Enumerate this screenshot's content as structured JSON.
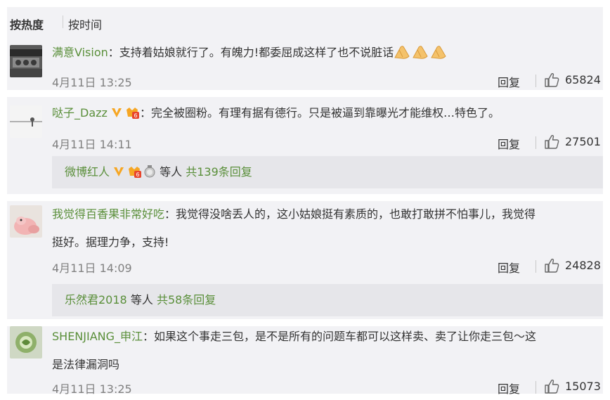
{
  "sort": {
    "hot": "按热度",
    "time": "按时间"
  },
  "comments": [
    {
      "user": "满意Vision",
      "colon": "：",
      "text": "支持着姑娘就行了。有魄力!都委屈成这样了也不说脏话",
      "time": "4月11日 13:25",
      "reply": "回复",
      "likes": "65824",
      "emoji_count": 3
    },
    {
      "user": "哒子_Dazz",
      "colon": "：",
      "text": "完全被圈粉。有理有据有德行。只是被逼到靠曝光才能维权…特色了。",
      "time": "4月11日 14:11",
      "reply": "回复",
      "likes": "27501",
      "sub": {
        "name": "微博红人",
        "deng": "等人",
        "total": "共139条回复"
      }
    },
    {
      "user": "我觉得百香果非常好吃",
      "colon": "：",
      "text_line1": "我觉得没啥丢人的，这小姑娘挺有素质的，也敢打敢拼不怕事儿，我觉得",
      "text_line2": "挺好。据理力争，支持!",
      "time": "4月11日 14:09",
      "reply": "回复",
      "likes": "24828",
      "sub": {
        "name": "乐然君2018",
        "deng": "等人",
        "total": "共58条回复"
      }
    },
    {
      "user": "SHENJIANG_申江",
      "colon": "：",
      "text_line1": "如果这个事走三包，是不是所有的问题车都可以这样卖、卖了让你走三包～这",
      "text_line2": "是法律漏洞吗",
      "time": "4月11日 13:25",
      "reply": "回复",
      "likes": "15073"
    }
  ],
  "colors": {
    "username": "#eb7350",
    "green": "#5a8f3a",
    "panel": "#f2f2f5",
    "sub_panel": "#e6e6ea"
  },
  "icons": [
    "thumbs-up-icon",
    "verified-v-icon",
    "vip-badge-icon",
    "medal-icon",
    "clap-emoji"
  ]
}
